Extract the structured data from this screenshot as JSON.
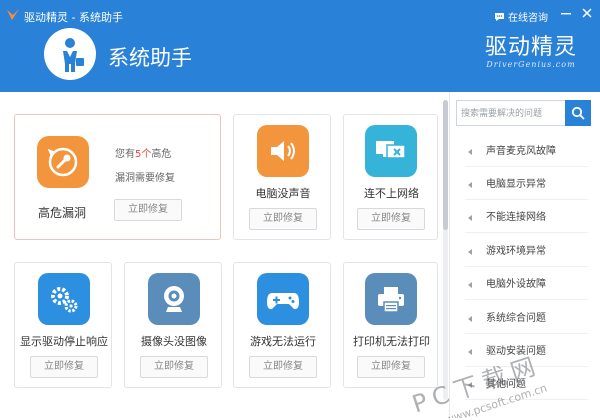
{
  "window": {
    "title": "驱动精灵 - 系统助手",
    "consult_label": "在线咨询",
    "colors": {
      "header": "#2a82d8",
      "alert": "#e8483b"
    }
  },
  "header": {
    "page_title": "系统助手",
    "brand_cn": "驱动精灵",
    "brand_en": "DriverGenius.com"
  },
  "featured": {
    "title": "高危漏洞",
    "desc_prefix": "您有",
    "count": "5个",
    "desc_suffix": "高危",
    "desc_line2": "漏洞需要修复",
    "button": "立即修复"
  },
  "cards": [
    {
      "label": "电脑没声音",
      "button": "立即修复",
      "icon": "speaker-icon"
    },
    {
      "label": "连不上网络",
      "button": "立即修复",
      "icon": "network-monitor-icon"
    },
    {
      "label": "显示驱动停止响应",
      "button": "立即修复",
      "icon": "gears-icon"
    },
    {
      "label": "摄像头没图像",
      "button": "立即修复",
      "icon": "webcam-icon"
    },
    {
      "label": "游戏无法运行",
      "button": "立即修复",
      "icon": "gamepad-icon"
    },
    {
      "label": "打印机无法打印",
      "button": "立即修复",
      "icon": "printer-icon"
    }
  ],
  "search": {
    "placeholder": "搜索需要解决的问题"
  },
  "categories": [
    "声音麦克风故障",
    "电脑显示异常",
    "不能连接网络",
    "游戏环境异常",
    "电脑外设故障",
    "系统综合问题",
    "驱动安装问题",
    "其他问题"
  ],
  "watermark": {
    "line1": "PC下载网",
    "line2": "www.pcsoft.com.cn"
  }
}
